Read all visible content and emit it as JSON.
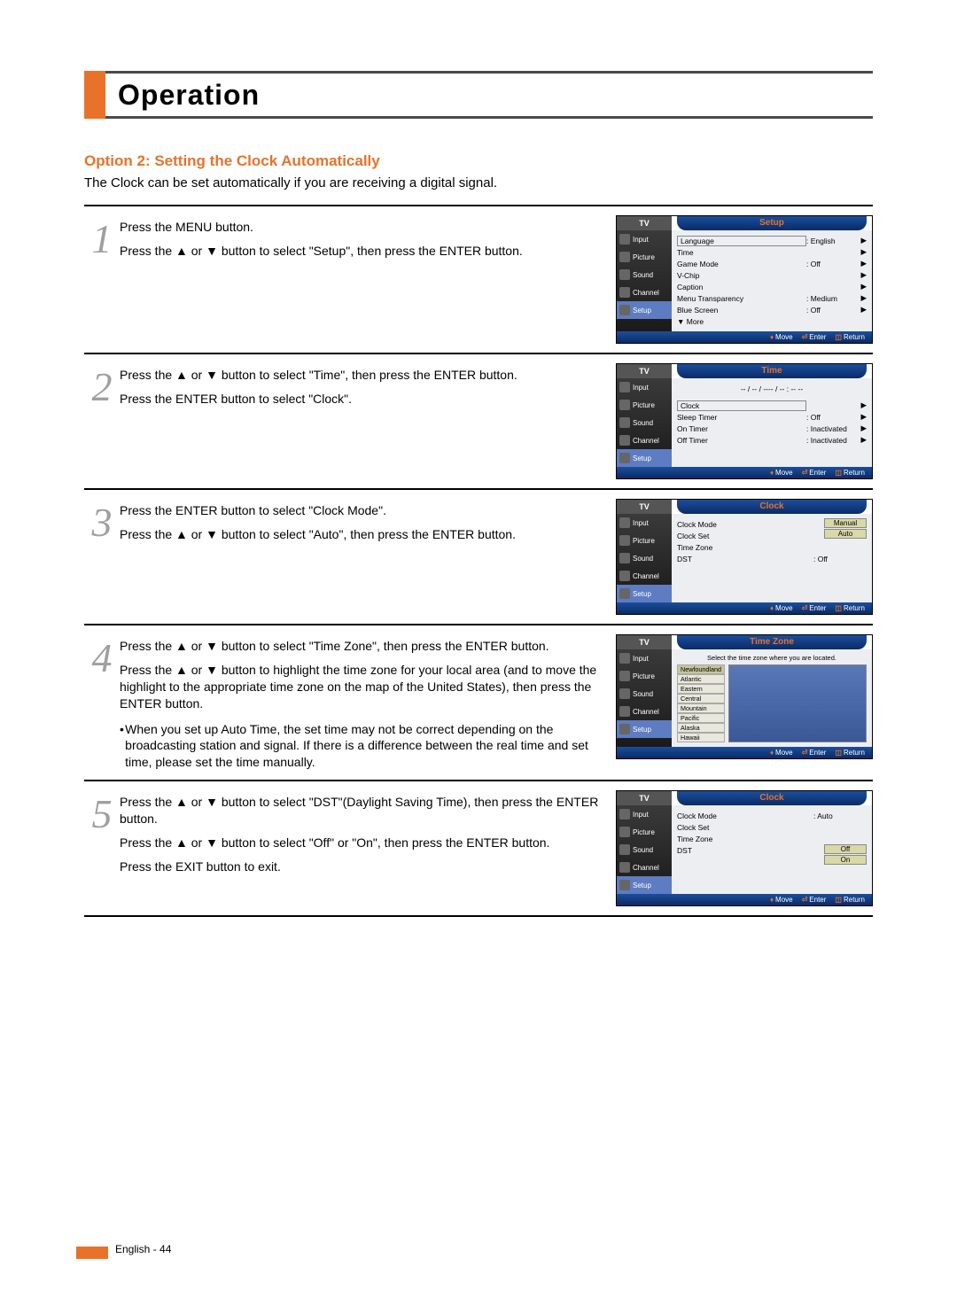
{
  "page": {
    "title": "Operation",
    "subhead": "Option 2: Setting the Clock Automatically",
    "intro": "The Clock can be set automatically if you are receiving a digital signal.",
    "footer": "English - 44"
  },
  "sidebar": {
    "items": [
      {
        "label": "Input"
      },
      {
        "label": "Picture"
      },
      {
        "label": "Sound"
      },
      {
        "label": "Channel"
      },
      {
        "label": "Setup"
      }
    ],
    "tv": "TV"
  },
  "osd_footer": {
    "move": "Move",
    "enter": "Enter",
    "return": "Return"
  },
  "steps": [
    {
      "num": "1",
      "text1": "Press the MENU button.",
      "text2": "Press the ▲ or ▼ button to select \"Setup\", then press the ENTER button.",
      "osd": {
        "title": "Setup",
        "rows": [
          {
            "label": "Language",
            "value": ": English",
            "boxed": true
          },
          {
            "label": "Time",
            "value": ""
          },
          {
            "label": "Game Mode",
            "value": ": Off"
          },
          {
            "label": "V-Chip",
            "value": ""
          },
          {
            "label": "Caption",
            "value": ""
          },
          {
            "label": "Menu Transparency",
            "value": ": Medium"
          },
          {
            "label": "Blue Screen",
            "value": ": Off"
          },
          {
            "label": "▼ More",
            "value": ""
          }
        ]
      }
    },
    {
      "num": "2",
      "text1": "Press the ▲ or ▼ button to select \"Time\", then press the ENTER button.",
      "text2": "Press the ENTER button to select \"Clock\".",
      "osd": {
        "title": "Time",
        "datetime": "-- / -- / ---- /  --  :  --  --",
        "rows": [
          {
            "label": "Clock",
            "value": "",
            "boxed": true
          },
          {
            "label": "Sleep Timer",
            "value": ": Off"
          },
          {
            "label": "On Timer",
            "value": ": Inactivated"
          },
          {
            "label": "Off Timer",
            "value": ": Inactivated"
          }
        ]
      }
    },
    {
      "num": "3",
      "text1": "Press the ENTER button to select \"Clock Mode\".",
      "text2": "Press the ▲ or ▼ button to select \"Auto\", then press the ENTER button.",
      "osd": {
        "title": "Clock",
        "rows": [
          {
            "label": "Clock Mode",
            "value": ""
          },
          {
            "label": "Clock Set",
            "value": ""
          },
          {
            "label": "Time Zone",
            "value": ""
          },
          {
            "label": "DST",
            "value": ": Off"
          }
        ],
        "options": [
          "Manual",
          "Auto"
        ]
      }
    },
    {
      "num": "4",
      "text1": "Press the ▲ or ▼ button to select \"Time Zone\", then press the ENTER button.",
      "text2": "Press the ▲ or ▼ button to highlight the time zone for your local area (and to move the highlight to the appropriate time zone on the map of the United States), then press the ENTER button.",
      "bullet": "When you set up Auto Time, the set time may not be correct depending on the broadcasting station and signal. If there is a difference between the real time and set time, please set the time manually.",
      "osd": {
        "title": "Time Zone",
        "hint": "Select the time zone where you are located.",
        "zones": [
          "Newfoundland",
          "Atlantic",
          "Eastern",
          "Central",
          "Mountain",
          "Pacific",
          "Alaska",
          "Hawaii"
        ]
      }
    },
    {
      "num": "5",
      "text1": "Press the ▲ or ▼ button to select \"DST\"(Daylight Saving Time), then press the ENTER button.",
      "text2": "Press the ▲ or ▼ button to select \"Off\" or \"On\", then press the ENTER button.",
      "text3": "Press the EXIT button to exit.",
      "osd": {
        "title": "Clock",
        "rows": [
          {
            "label": "Clock Mode",
            "value": ": Auto"
          },
          {
            "label": "Clock Set",
            "value": ""
          },
          {
            "label": "Time Zone",
            "value": ""
          },
          {
            "label": "DST",
            "value": ""
          }
        ],
        "options": [
          "Off",
          "On"
        ]
      }
    }
  ]
}
